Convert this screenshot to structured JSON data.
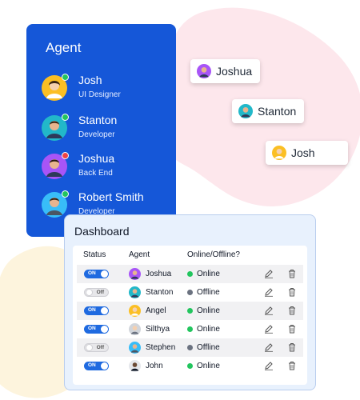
{
  "colors": {
    "panel_blue": "#1557d8",
    "online_green": "#22c55e",
    "offline_gray": "#6b7280",
    "blob_pink": "#fde7ec",
    "blob_yellow": "#fdf4dd",
    "toggle_on": "#1f6ae0"
  },
  "agent_panel": {
    "title": "Agent",
    "items": [
      {
        "name": "Josh",
        "role": "UI Designer",
        "avatar_bg": "#fbbf24",
        "status_color": "#22c55e"
      },
      {
        "name": "Stanton",
        "role": "Developer",
        "avatar_bg": "#22b8c9",
        "status_color": "#22c55e"
      },
      {
        "name": "Joshua",
        "role": "Back End",
        "avatar_bg": "#a855f7",
        "status_color": "#ef4444"
      },
      {
        "name": "Robert Smith",
        "role": "Developer",
        "avatar_bg": "#38bdf8",
        "status_color": "#22c55e"
      }
    ]
  },
  "chips": [
    {
      "name": "Joshua",
      "avatar_bg": "#a855f7"
    },
    {
      "name": "Stanton",
      "avatar_bg": "#22b8c9"
    },
    {
      "name": "Josh",
      "avatar_bg": "#fbbf24"
    }
  ],
  "dashboard": {
    "title": "Dashboard",
    "headers": {
      "status": "Status",
      "agent": "Agent",
      "online": "Online/Offline?"
    },
    "rows": [
      {
        "toggle": "ON",
        "agent": "Joshua",
        "presence": "Online",
        "avatar_bg": "#a855f7"
      },
      {
        "toggle": "Off",
        "agent": "Stanton",
        "presence": "Offline",
        "avatar_bg": "#22b8c9"
      },
      {
        "toggle": "ON",
        "agent": "Angel",
        "presence": "Online",
        "avatar_bg": "#fbbf24"
      },
      {
        "toggle": "ON",
        "agent": "Silthya",
        "presence": "Online",
        "avatar_bg": "#d1d5db"
      },
      {
        "toggle": "Off",
        "agent": "Stephen",
        "presence": "Offline",
        "avatar_bg": "#38bdf8"
      },
      {
        "toggle": "ON",
        "agent": "John",
        "presence": "Online",
        "avatar_bg": "#e5e7eb"
      }
    ]
  }
}
